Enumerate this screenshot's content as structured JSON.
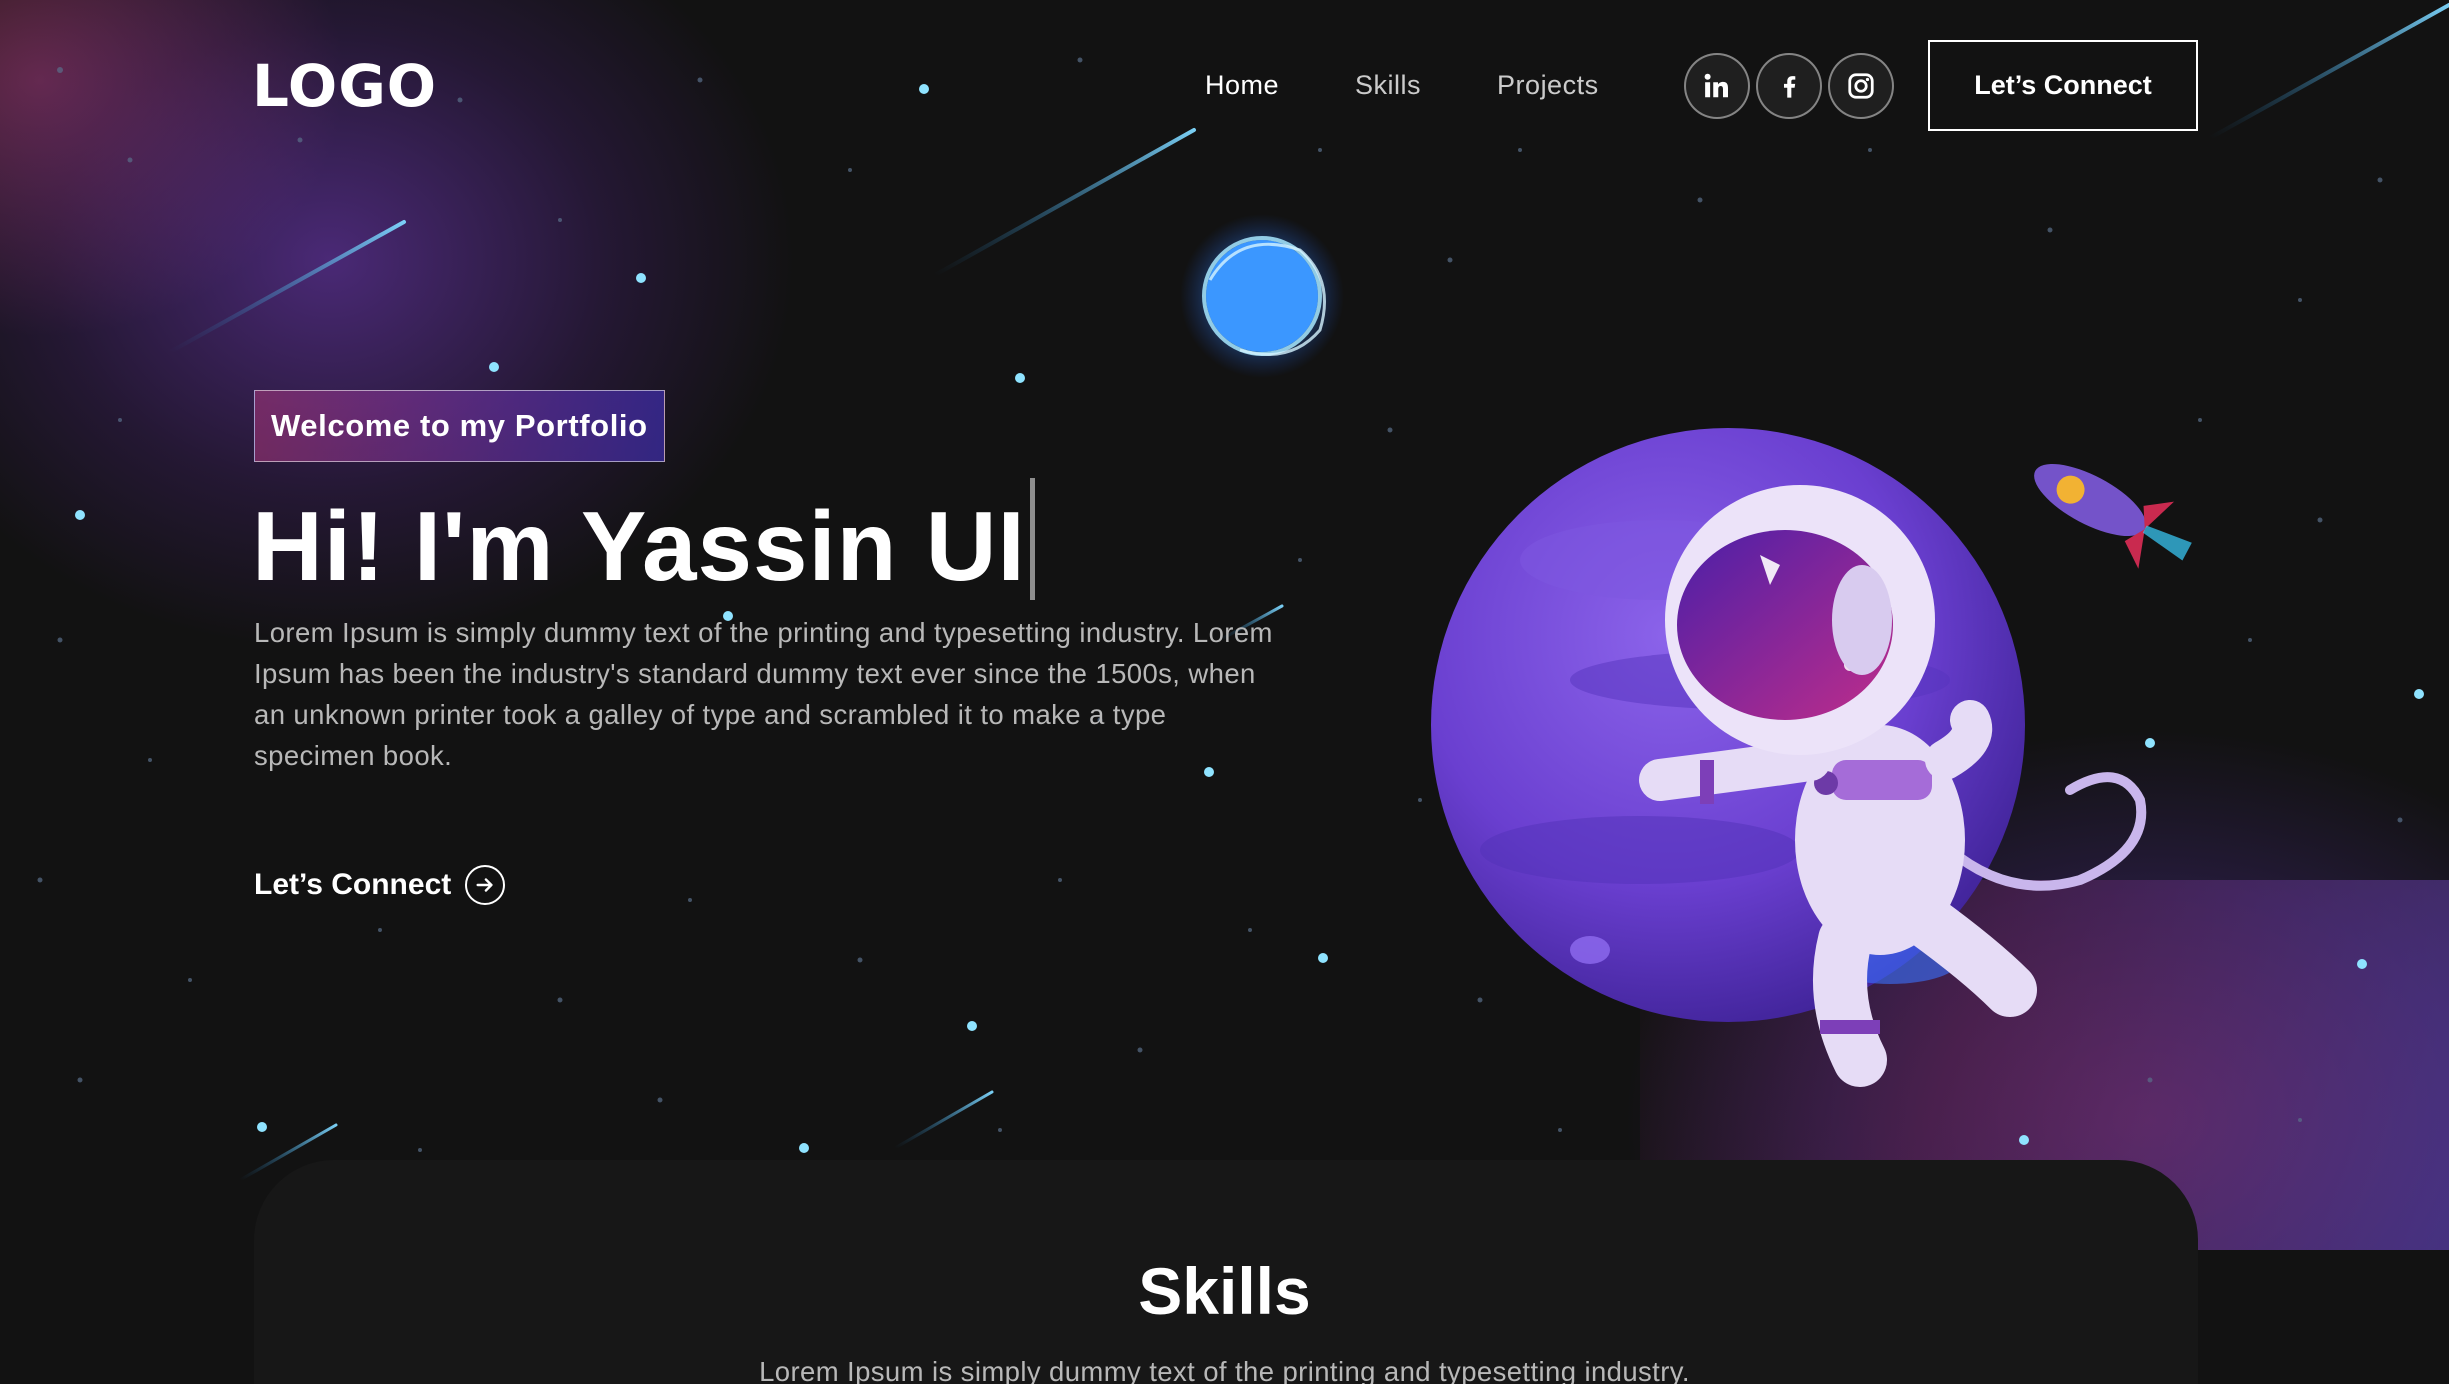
{
  "navbar": {
    "logo": "LOGO",
    "links": [
      "Home",
      "Skills",
      "Projects"
    ],
    "social_icons": [
      "linkedin-icon",
      "facebook-icon",
      "instagram-icon"
    ],
    "connect_label": "Let’s Connect"
  },
  "hero": {
    "tagline": "Welcome to my Portfolio",
    "title": "Hi! I'm Yassin UI",
    "description": "Lorem Ipsum is simply dummy text of the printing and typesetting industry. Lorem Ipsum has been the industry's standard dummy text ever since the 1500s, when an unknown printer took a galley of type and scrambled it to make a type specimen book.",
    "cta_label": "Let’s Connect"
  },
  "skills": {
    "title": "Skills",
    "description": "Lorem Ipsum is simply dummy text of the printing and typesetting industry."
  },
  "colors": {
    "background": "#121212",
    "tagline_gradient_start": "#aa367c",
    "tagline_gradient_end": "#4a2fbd",
    "planet": "#6a3fd0",
    "star": "#8fe3ff"
  }
}
